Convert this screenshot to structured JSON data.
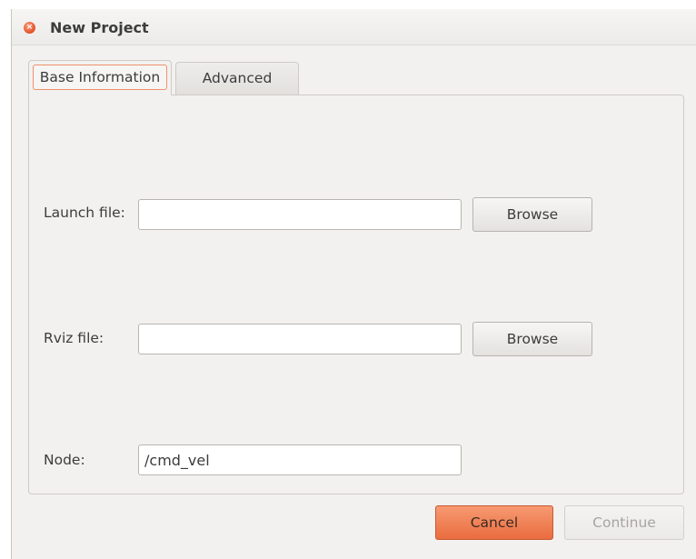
{
  "window": {
    "title": "New Project"
  },
  "tabs": [
    {
      "label": "Base Information",
      "active": true
    },
    {
      "label": "Advanced",
      "active": false
    }
  ],
  "form": {
    "launch_file": {
      "label": "Launch file:",
      "value": "",
      "browse_label": "Browse"
    },
    "rviz_file": {
      "label": "Rviz file:",
      "value": "",
      "browse_label": "Browse"
    },
    "node": {
      "label": "Node:",
      "value": "/cmd_vel"
    }
  },
  "footer": {
    "cancel_label": "Cancel",
    "continue_label": "Continue"
  },
  "colors": {
    "accent": "#ea6c3f",
    "focus_ring": "#f0906a",
    "window_bg": "#f2f1f0"
  },
  "icons": {
    "close": "close-icon"
  }
}
